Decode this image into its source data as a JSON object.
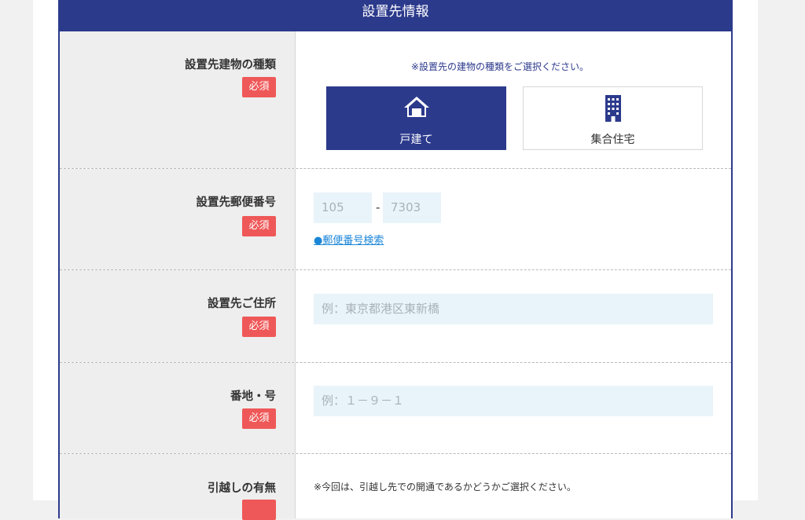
{
  "section_title": "設置先情報",
  "required_label": "必須",
  "building_type": {
    "label": "設置先建物の種類",
    "note": "※設置先の建物の種類をご選択ください。",
    "options": [
      {
        "label": "戸建て",
        "icon": "house-icon",
        "selected": true
      },
      {
        "label": "集合住宅",
        "icon": "apartment-building-icon",
        "selected": false
      }
    ]
  },
  "postal_code": {
    "label": "設置先郵便番号",
    "first_value": "105",
    "separator": "-",
    "second_value": "7303",
    "search_link": "●郵便番号検索"
  },
  "address": {
    "label": "設置先ご住所",
    "placeholder": "例：東京都港区東新橋"
  },
  "block_number": {
    "label": "番地・号",
    "placeholder": "例：１－９－１"
  },
  "moving": {
    "label": "引越しの有無",
    "note": "※今回は、引越し先での開通であるかどうかご選択ください。"
  },
  "colors": {
    "primary": "#2c3a8c",
    "required": "#ef5858",
    "input_bg": "#e9f4fa",
    "link": "#1a86d8"
  }
}
